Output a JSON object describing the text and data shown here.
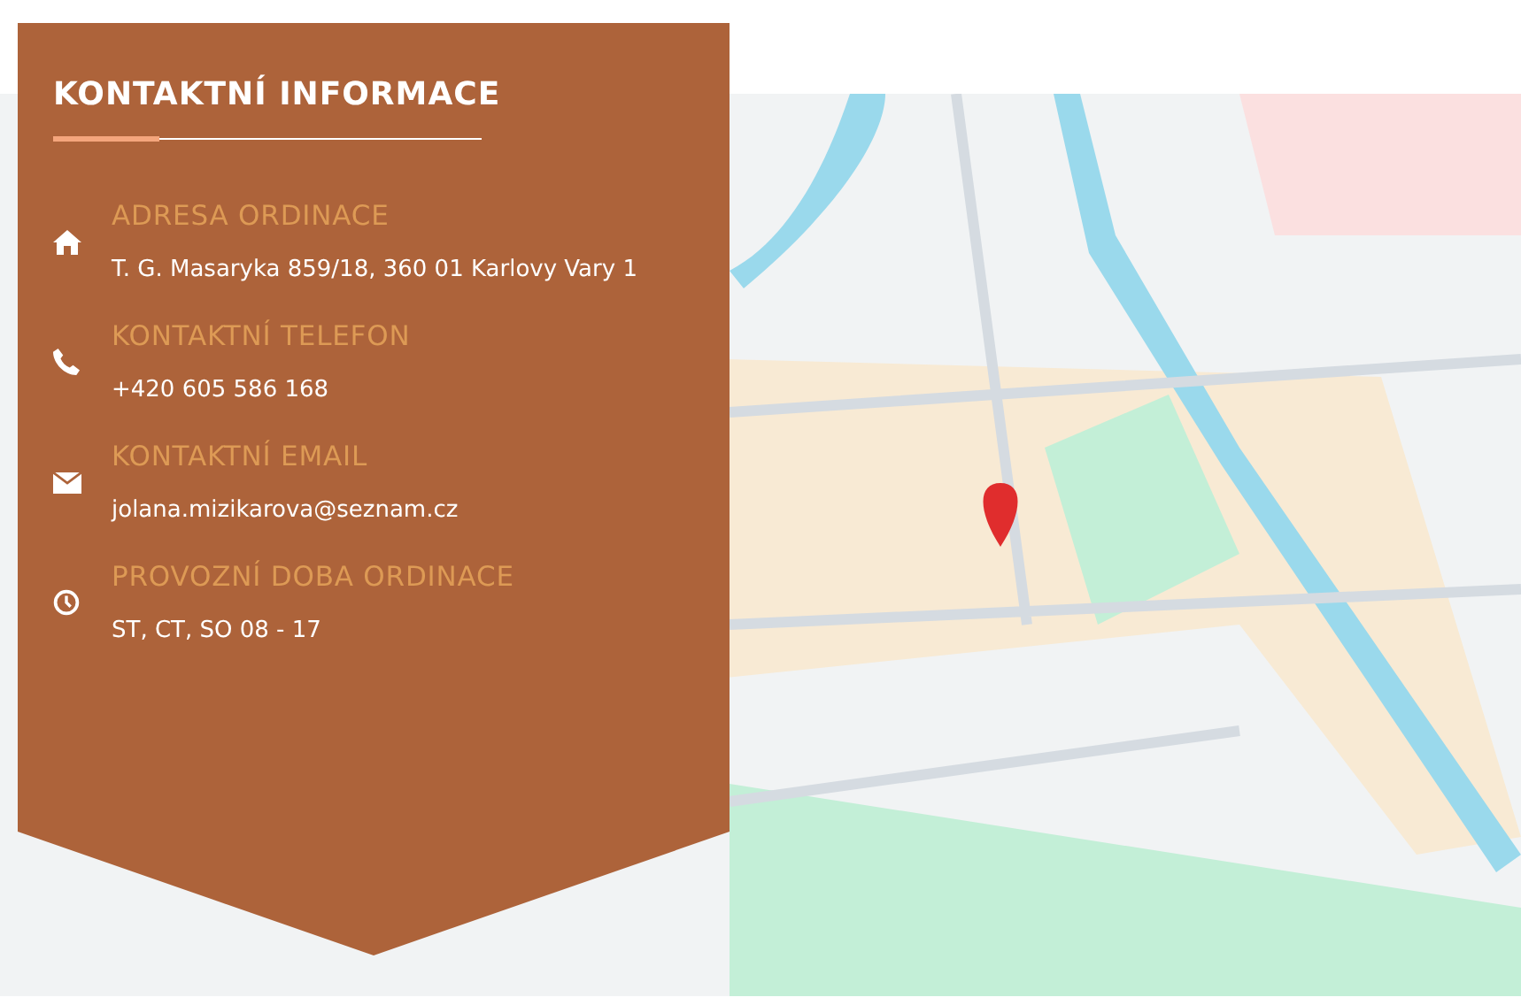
{
  "contact_card": {
    "title": "KONTAKTNÍ INFORMACE",
    "items": [
      {
        "kind": "address",
        "label": "ADRESA ORDINACE",
        "value": "T. G. Masaryka 859/18, 360 01 Karlovy Vary 1"
      },
      {
        "kind": "phone",
        "label": "KONTAKTNÍ TELEFON",
        "value": "+420 605 586 168"
      },
      {
        "kind": "email",
        "label": "KONTAKTNÍ EMAIL",
        "value": "jolana.mizikarova@seznam.cz"
      },
      {
        "kind": "hours",
        "label": "PROVOZNÍ DOBA ORDINACE",
        "value": "ST, CT, SO 08 - 17"
      }
    ]
  }
}
